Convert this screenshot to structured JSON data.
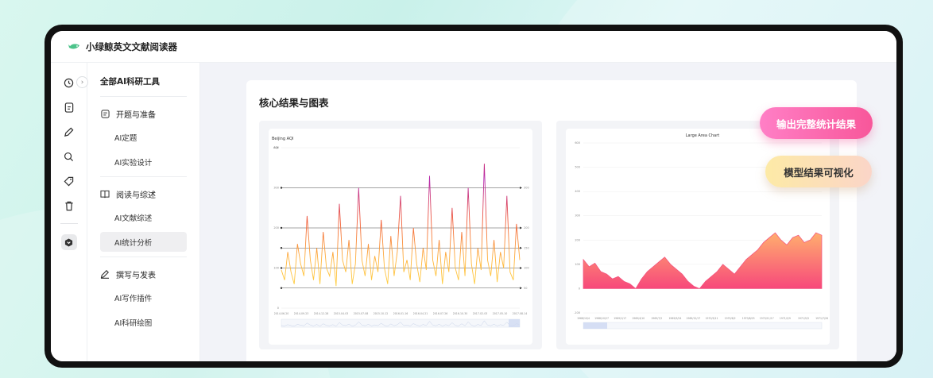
{
  "app": {
    "title": "小绿鲸英文文献阅读器"
  },
  "menu": {
    "header": "全部AI科研工具",
    "groups": [
      {
        "label": "开题与准备",
        "items": [
          "AI定题",
          "AI实验设计"
        ]
      },
      {
        "label": "阅读与综述",
        "items": [
          "AI文献综述",
          "AI统计分析"
        ]
      },
      {
        "label": "撰写与发表",
        "items": [
          "AI写作插件",
          "AI科研绘图"
        ]
      }
    ],
    "active_item": "AI统计分析"
  },
  "main": {
    "card_title": "核心结果与图表"
  },
  "badges": {
    "pink": "输出完整统计结果",
    "yellow": "模型结果可视化"
  },
  "colors": {
    "accent_green": "#4cc38a",
    "pink": "#f8579a",
    "yellow": "#fde7a8"
  },
  "chart_data": [
    {
      "type": "line",
      "title": "Beijing AQI",
      "ylabel": "AQI",
      "x": [
        "2014-06-20",
        "2014-09-23",
        "2014-12-28",
        "2015-04-03",
        "2015-07-08",
        "2015-10-12",
        "2016-01-16",
        "2016-04-21",
        "2016-07-26",
        "2016-10-30",
        "2017-02-03",
        "2017-05-10",
        "2017-08-14"
      ],
      "ylim": [
        0,
        400
      ],
      "yticks": [
        0,
        100,
        200,
        300,
        400
      ],
      "thresholds": [
        50,
        100,
        150,
        200,
        300
      ],
      "series": [
        {
          "values": [
            95,
            70,
            140,
            90,
            60,
            160,
            110,
            80,
            230,
            120,
            70,
            150,
            60,
            190,
            100,
            80,
            140,
            55,
            260,
            120,
            90,
            170,
            60,
            110,
            300,
            120,
            80,
            160,
            70,
            130,
            90,
            220,
            100,
            60,
            180,
            80,
            140,
            280,
            90,
            120,
            70,
            200,
            110,
            65,
            150,
            95,
            330,
            120,
            80,
            170,
            60,
            140,
            90,
            250,
            100,
            70,
            190,
            80,
            300,
            110,
            60,
            150,
            95,
            360,
            120,
            80,
            170,
            65,
            140,
            100,
            280,
            90,
            70,
            210,
            120
          ]
        }
      ]
    },
    {
      "type": "area",
      "title": "Large Area Chart",
      "x": [
        "1968/10/4",
        "1968/10/27",
        "1969/1/17",
        "1969/4/10",
        "1969/7/2",
        "1969/9/24",
        "1969/12/17",
        "1970/3/11",
        "1970/6/2",
        "1970/8/25",
        "1970/11/17",
        "1971/2/9",
        "1971/5/3",
        "1971/7/26"
      ],
      "ylim": [
        -100,
        600
      ],
      "yticks": [
        -100,
        0,
        100,
        200,
        300,
        400,
        500,
        600
      ],
      "series": [
        {
          "values": [
            120,
            90,
            105,
            70,
            60,
            40,
            50,
            30,
            20,
            0,
            40,
            70,
            90,
            110,
            130,
            100,
            80,
            60,
            30,
            10,
            0,
            30,
            50,
            70,
            100,
            80,
            60,
            90,
            120,
            140,
            160,
            190,
            210,
            230,
            200,
            180,
            210,
            220,
            190,
            200,
            230,
            220
          ]
        }
      ]
    }
  ]
}
